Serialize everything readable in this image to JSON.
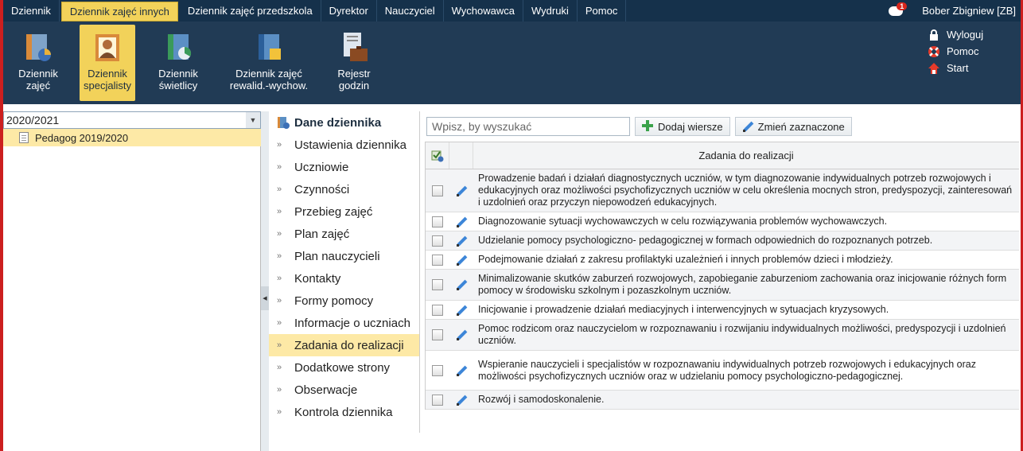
{
  "menu": {
    "tabs": [
      {
        "label": "Dziennik",
        "active": false
      },
      {
        "label": "Dziennik zajęć innych",
        "active": true
      },
      {
        "label": "Dziennik zajęć przedszkola",
        "active": false
      },
      {
        "label": "Dyrektor",
        "active": false
      },
      {
        "label": "Nauczyciel",
        "active": false
      },
      {
        "label": "Wychowawca",
        "active": false
      },
      {
        "label": "Wydruki",
        "active": false
      },
      {
        "label": "Pomoc",
        "active": false
      }
    ],
    "notification_count": "1",
    "user": "Bober Zbigniew [ZB]"
  },
  "toolbar": {
    "buttons": [
      {
        "line1": "Dziennik",
        "line2": "zajęć",
        "icon": "journal-icon"
      },
      {
        "line1": "Dziennik",
        "line2": "specjalisty",
        "icon": "specialist-icon",
        "active": true
      },
      {
        "line1": "Dziennik",
        "line2": "świetlicy",
        "icon": "common-room-icon"
      },
      {
        "line1": "Dziennik zajęć",
        "line2": "rewalid.-wychow.",
        "icon": "rehab-journal-icon"
      },
      {
        "line1": "Rejestr",
        "line2": "godzin",
        "icon": "hours-register-icon"
      }
    ],
    "links": [
      {
        "label": "Wyloguj",
        "icon": "lock-icon"
      },
      {
        "label": "Pomoc",
        "icon": "lifebuoy-icon"
      },
      {
        "label": "Start",
        "icon": "home-icon"
      }
    ]
  },
  "left": {
    "year": "2020/2021",
    "tree_item": "Pedagog 2019/2020"
  },
  "nav": {
    "header": "Dane dziennika",
    "items": [
      "Ustawienia dziennika",
      "Uczniowie",
      "Czynności",
      "Przebieg zajęć",
      "Plan zajęć",
      "Plan nauczycieli",
      "Kontakty",
      "Formy pomocy",
      "Informacje o uczniach",
      "Zadania do realizacji",
      "Dodatkowe strony",
      "Obserwacje",
      "Kontrola dziennika"
    ],
    "active_index": 9
  },
  "main": {
    "search_placeholder": "Wpisz, by wyszukać",
    "add_button": "Dodaj wiersze",
    "edit_button": "Zmień zaznaczone",
    "column_header": "Zadania do realizacji",
    "rows": [
      "Prowadzenie badań i działań diagnostycznych uczniów, w tym diagnozowanie indywidualnych potrzeb rozwojowych i edukacyjnych oraz możliwości psychofizycznych uczniów w celu określenia mocnych stron, predyspozycji, zainteresowań i uzdolnień oraz przyczyn niepowodzeń edukacyjnych.",
      "Diagnozowanie sytuacji wychowawczych w celu rozwiązywania problemów wychowawczych.",
      "Udzielanie pomocy psychologiczno- pedagogicznej w formach odpowiednich do rozpoznanych potrzeb.",
      "Podejmowanie działań z zakresu profilaktyki uzależnień i innych problemów dzieci i młodzieży.",
      "Minimalizowanie skutków zaburzeń rozwojowych, zapobieganie zaburzeniom zachowania oraz inicjowanie różnych form pomocy w środowisku szkolnym i pozaszkolnym uczniów.",
      "Inicjowanie i prowadzenie działań mediacyjnych i interwencyjnych w sytuacjach kryzysowych.",
      "Pomoc rodzicom  oraz nauczycielom w rozpoznawaniu i rozwijaniu indywidualnych możliwości, predyspozycji i uzdolnień uczniów.",
      "Wspieranie nauczycieli i specjalistów w rozpoznawaniu indywidualnych potrzeb rozwojowych i edukacyjnych oraz możliwości psychofizycznych uczniów oraz w udzielaniu pomocy psychologiczno-pedagogicznej.",
      "Rozwój i samodoskonalenie."
    ]
  },
  "colors": {
    "menubar": "#15314b",
    "toolbar": "#213b55",
    "accent": "#f2d25a",
    "highlight": "#fde9a6",
    "frame": "#cc1f1f"
  }
}
